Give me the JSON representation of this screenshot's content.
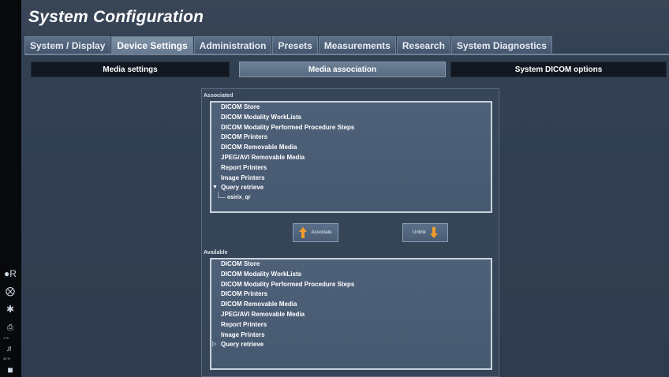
{
  "app": {
    "title": "System Configuration"
  },
  "tabs": [
    {
      "label": "System / Display",
      "active": false
    },
    {
      "label": "Device Settings",
      "active": true
    },
    {
      "label": "Administration",
      "active": false
    },
    {
      "label": "Presets",
      "active": false
    },
    {
      "label": "Measurements",
      "active": false
    },
    {
      "label": "Research",
      "active": false
    },
    {
      "label": "System Diagnostics",
      "active": false
    }
  ],
  "subtabs": [
    {
      "label": "Media settings",
      "active": false
    },
    {
      "label": "Media association",
      "active": true
    },
    {
      "label": "System DICOM options",
      "active": false
    }
  ],
  "associated": {
    "label": "Associated",
    "items": [
      "DICOM Store",
      "DICOM Modality WorkLists",
      "DICOM Modality Performed Procedure Steps",
      "DICOM Printers",
      "DICOM Removable Media",
      "JPEG/AVI Removable Media",
      "Report Printers",
      "Image Printers"
    ],
    "tree": {
      "label": "Query retrieve",
      "expanded": true,
      "children": [
        "osirix_qr"
      ]
    }
  },
  "buttons": {
    "associate": {
      "label": "Associate",
      "icon": "arrow-up-icon"
    },
    "unlink": {
      "label": "Unlink",
      "icon": "arrow-down-icon"
    }
  },
  "available": {
    "label": "Available",
    "items": [
      "DICOM Store",
      "DICOM Modality WorkLists",
      "DICOM Modality Performed Procedure Steps",
      "DICOM Printers",
      "DICOM Removable Media",
      "JPEG/AVI Removable Media",
      "Report Printers",
      "Image Printers"
    ],
    "tree": {
      "label": "Query retrieve",
      "expanded": false
    }
  },
  "sidebar": {
    "icons": [
      "probe-icon",
      "close-circle-icon",
      "mode-icon",
      "printer-icon",
      "volume-icon",
      "user-icon"
    ],
    "printer_text": "1 %",
    "volume_text": "44 %"
  },
  "colors": {
    "accent_orange": "#f39c2a",
    "background": "#324152",
    "active_subtab": "#6e8096"
  }
}
